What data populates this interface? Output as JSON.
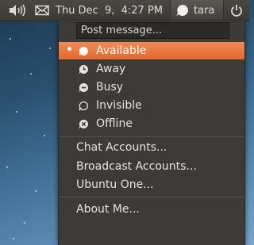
{
  "panel": {
    "clock": "Thu Dec  9,  4:27 PM",
    "user_name": "tara"
  },
  "menu": {
    "post_placeholder": "Post message...",
    "status_items": [
      {
        "label": "Available",
        "selected": true,
        "icon": "available-icon"
      },
      {
        "label": "Away",
        "selected": false,
        "icon": "away-icon"
      },
      {
        "label": "Busy",
        "selected": false,
        "icon": "busy-icon"
      },
      {
        "label": "Invisible",
        "selected": false,
        "icon": "invisible-icon"
      },
      {
        "label": "Offline",
        "selected": false,
        "icon": "offline-icon"
      }
    ],
    "account_items": [
      {
        "label": "Chat Accounts..."
      },
      {
        "label": "Broadcast Accounts..."
      },
      {
        "label": "Ubuntu One..."
      }
    ],
    "about": "About Me..."
  },
  "colors": {
    "accent": "#e2682f",
    "menu_bg": "#3c3b37",
    "panel_bg": "#3b3a36"
  }
}
